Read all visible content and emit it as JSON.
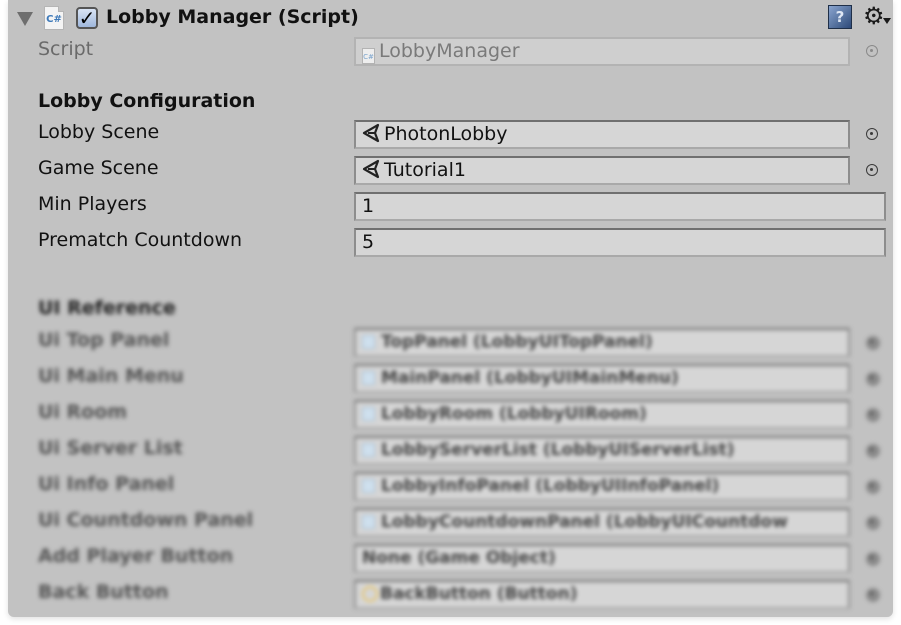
{
  "component": {
    "title": "Lobby Manager (Script)",
    "enabled": true,
    "icons": {
      "foldout": "foldout-triangle-icon",
      "script": "csharp-script-icon",
      "help": "help-book-icon",
      "settings": "gear-icon"
    }
  },
  "script_field": {
    "label": "Script",
    "value": "LobbyManager",
    "icon": "csharp-script-icon"
  },
  "sections": [
    {
      "header": "Lobby Configuration",
      "fields": [
        {
          "label": "Lobby Scene",
          "value": "PhotonLobby",
          "type": "object",
          "icon": "unity-scene-icon"
        },
        {
          "label": "Game Scene",
          "value": "Tutorial1",
          "type": "object",
          "icon": "unity-scene-icon"
        },
        {
          "label": "Min Players",
          "value": "1",
          "type": "number"
        },
        {
          "label": "Prematch Countdown",
          "value": "5",
          "type": "number"
        }
      ]
    },
    {
      "header": "UI Reference",
      "fields": [
        {
          "label": "Ui Top Panel",
          "value": "TopPanel (LobbyUITopPanel)",
          "icon": "game-object-icon"
        },
        {
          "label": "Ui Main Menu",
          "value": "MainPanel (LobbyUIMainMenu)",
          "icon": "game-object-icon"
        },
        {
          "label": "Ui Room",
          "value": "LobbyRoom (LobbyUIRoom)",
          "icon": "game-object-icon"
        },
        {
          "label": "Ui Server List",
          "value": "LobbyServerList (LobbyUIServerList)",
          "icon": "game-object-icon"
        },
        {
          "label": "Ui Info Panel",
          "value": "LobbyInfoPanel (LobbyUIInfoPanel)",
          "icon": "game-object-icon"
        },
        {
          "label": "Ui Countdown Panel",
          "value": "LobbyCountdownPanel (LobbyUICountdow",
          "icon": "game-object-icon"
        },
        {
          "label": "Add Player Button",
          "value": "None (Game Object)",
          "icon": ""
        },
        {
          "label": "Back Button",
          "value": "BackButton (Button)",
          "icon": "button-icon"
        }
      ]
    }
  ]
}
